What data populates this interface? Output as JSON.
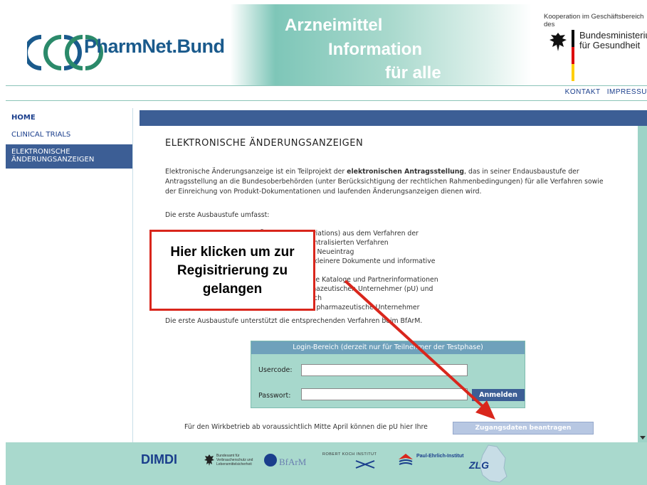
{
  "header": {
    "logo_text": "PharmNet.Bund",
    "headline_1": "Arzneimittel",
    "headline_2": "Information",
    "headline_3": "für alle",
    "kooperation": "Kooperation im Geschäftsbereich des",
    "ministry_line1": "Bundesministerium",
    "ministry_line2": "für Gesundheit"
  },
  "topbar": {
    "kontakt": "KONTAKT",
    "impressum": "IMPRESSU"
  },
  "nav": {
    "items": [
      {
        "label": "HOME"
      },
      {
        "label": "CLINICAL TRIALS"
      },
      {
        "label_line1": "ELEKTRONISCHE",
        "label_line2": "ÄNDERUNGSANZEIGEN"
      }
    ]
  },
  "main": {
    "title": "ELEKTRONISCHE ÄNDERUNGSANZEIGEN",
    "intro_pre": "Elektronische Änderungsanzeige ist ein Teilprojekt der ",
    "intro_bold": "elektronischen Antragsstellung",
    "intro_post": ", das in seiner Endausbaustufe der Antragsstellung an die Bundesoberbehörden (unter Berücksichtigung der rechtlichen Rahmenbedingungen) für alle Verfahren sowie der Einreichung von Produkt-Dokumentationen und laufenden Änderungsanzeigen dienen wird.",
    "ausbau_heading": "Die erste Ausbaustufe umfasst:",
    "list_lines": [
      "nderungsanzeigen (AA) und Änderungen (Variations) aus dem Verfahren der",
      "l Recognition Procedure, MRP) und dem dezentralisierten Verfahren",
      "kl. der Gegenüberstellung von Alteintrag und Neueintrag",
      "n Übermittlung von AA inkl. der Möglichkeit, kleinere Dokumente und informative",
      "",
      "ng der Datenqualität durch zentrale Daten wie Kataloge und Partnerinformationen",
      "stands in einem nur für den jeweiligen pharmazeutischen Unternehmer (pU) und",
      "örden (BOB) zugänglichen geschützten Bereich",
      "Mail-Adressen bzw. ein virtuelles Postfach für pharmazeutische Unternehmer"
    ],
    "support_text": "Die erste Ausbaustufe unterstützt die entsprechenden Verfahren beim BfArM.",
    "wirkbetrieb_text": "Für den Wirkbetrieb ab voraussichtlich Mitte April können die pU hier Ihre",
    "zugang_button": "Zugangsdaten beantragen"
  },
  "login": {
    "heading": "Login-Bereich (derzeit nur für Teilnehmer der Testphase)",
    "user_label": "Usercode:",
    "pass_label": "Passwort:",
    "user_value": "",
    "pass_value": "",
    "submit": "Anmelden"
  },
  "callout": {
    "line1": "Hier klicken um zur",
    "line2": "Regisitrierung zu",
    "line3": "gelangen"
  },
  "footer": {
    "dimdi": "DIMDI",
    "bvl": "Bundesamt für Verbraucherschutz und Lebensmittelsicherheit",
    "bfarm": "BfArM",
    "rki": "ROBERT KOCH INSTITUT",
    "pei": "Paul-Ehrlich-Institut",
    "zlg": "ZLG"
  },
  "colors": {
    "nav_blue": "#3c5e95",
    "teal": "#a9d9cd",
    "callout_red": "#d9261c"
  }
}
